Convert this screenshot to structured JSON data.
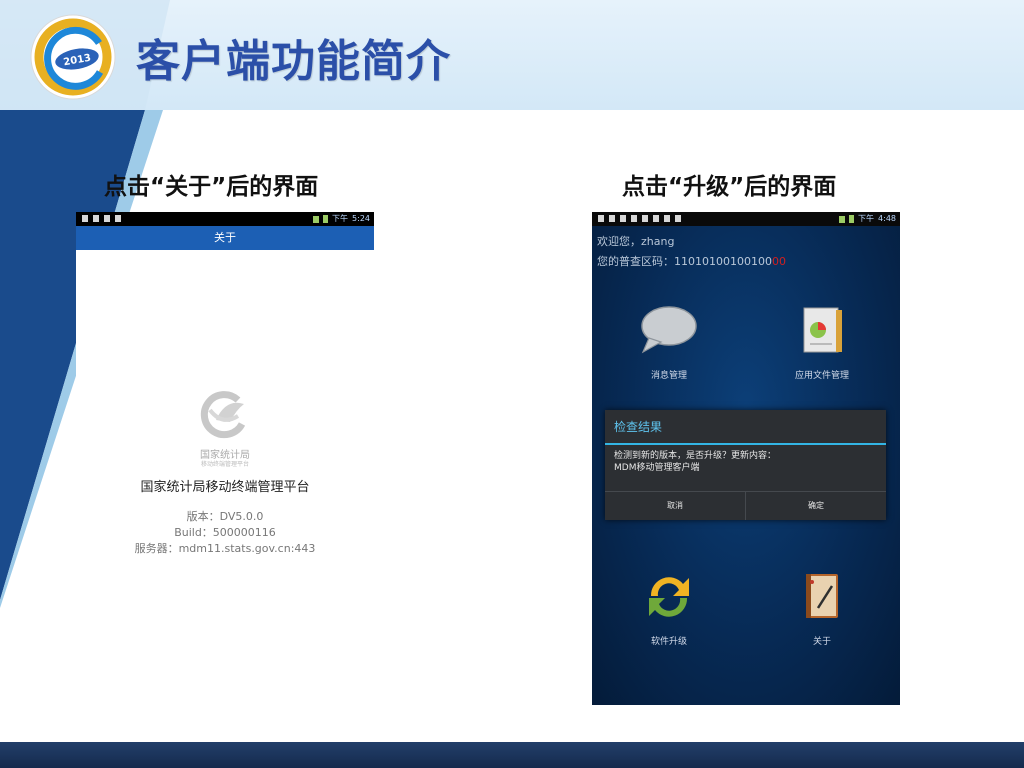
{
  "slide": {
    "title": "客户端功能简介",
    "caption_left": "点击“关于”后的界面",
    "caption_right": "点击“升级”后的界面",
    "logo_text": "2013"
  },
  "about_screen": {
    "status_time": "5:24",
    "status_ampm": "下午",
    "appbar_title": "关于",
    "org_name": "国家统计局",
    "org_subtitle": "移动终端管理平台",
    "platform_name": "国家统计局移动终端管理平台",
    "version": "版本：DV5.0.0",
    "build": "Build：500000116",
    "server": "服务器：mdm11.stats.gov.cn:443"
  },
  "upgrade_screen": {
    "status_time": "4:48",
    "status_ampm": "下午",
    "welcome": "欢迎您，zhang",
    "region_prefix": "您的普查区码：11010100100100",
    "region_suffix": "00",
    "tiles": [
      {
        "label": "消息管理",
        "icon": "chat-bubble-icon"
      },
      {
        "label": "应用文件管理",
        "icon": "document-chart-icon"
      },
      {
        "label": "软件升级",
        "icon": "refresh-arrows-icon"
      },
      {
        "label": "关于",
        "icon": "notebook-pen-icon"
      }
    ],
    "dialog": {
      "title": "检查结果",
      "body_line1": "检测到新的版本，是否升级？更新内容：",
      "body_line2": "MDM移动管理客户端",
      "cancel": "取消",
      "confirm": "确定"
    }
  },
  "colors": {
    "title_blue": "#2b4fa8",
    "appbar_blue": "#1c5fb4",
    "dialog_accent": "#33b5e5",
    "footer_navy": "#1b3560"
  }
}
